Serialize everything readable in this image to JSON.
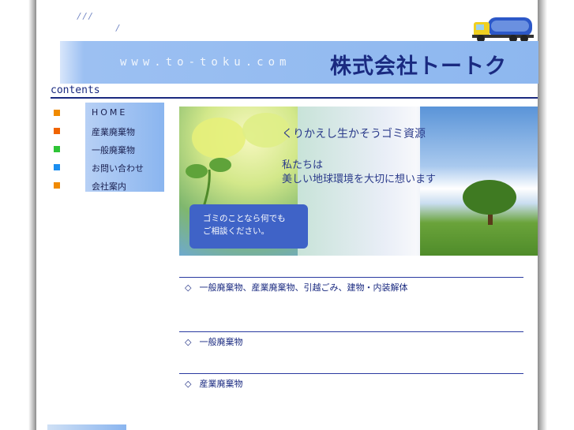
{
  "header": {
    "slashes_row1": "/    /    /",
    "slashes_row2": "/",
    "url": "www.to-toku.com",
    "company_name": "株式会社トートク"
  },
  "contents_label": "contents",
  "nav": {
    "items": [
      {
        "label": "HOME",
        "bullet_color": "#f08a00"
      },
      {
        "label": "産業廃棄物",
        "bullet_color": "#f06400"
      },
      {
        "label": "一般廃棄物",
        "bullet_color": "#2ec436"
      },
      {
        "label": "お問い合わせ",
        "bullet_color": "#1a8ef0"
      },
      {
        "label": "会社案内",
        "bullet_color": "#f08a00"
      }
    ]
  },
  "hero": {
    "line1": "くりかえし生かそうゴミ資源",
    "line2a": "私たちは",
    "line2b": "美しい地球環境を大切に想います",
    "box_line1": "ゴミのことなら何でも",
    "box_line2": "ご相談ください。"
  },
  "sections": [
    {
      "marker": "◇",
      "title": "一般廃棄物、産業廃棄物、引越ごみ、建物・内装解体"
    },
    {
      "marker": "◇",
      "title": "一般廃棄物"
    },
    {
      "marker": "◇",
      "title": "産業廃棄物"
    }
  ],
  "colors": {
    "accent": "#1a2a80",
    "banner": "#8db7ef",
    "hero_box": "#3f63c7"
  }
}
